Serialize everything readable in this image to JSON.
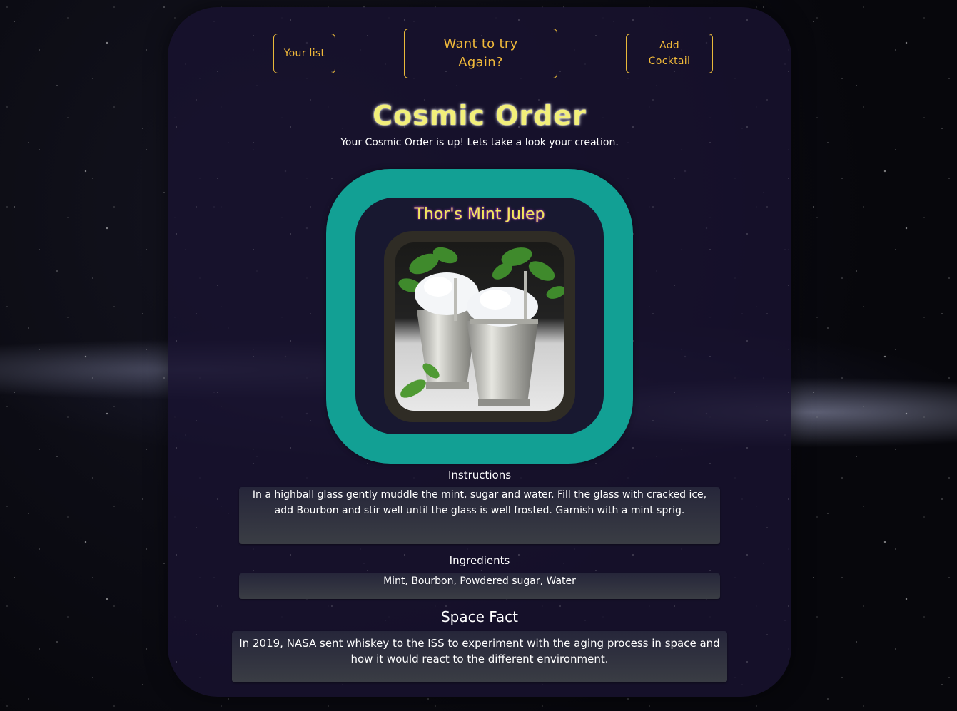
{
  "nav": {
    "list_label": "Your list",
    "again_label": "Want to try Again?",
    "add_label": "Add Cocktail"
  },
  "header": {
    "title": "Cosmic Order",
    "subtitle": "Your Cosmic Order is up! Lets take a look your creation."
  },
  "drink": {
    "name": "Thor's Mint Julep",
    "image_icon": "cocktail-photo"
  },
  "instructions": {
    "label": "Instructions",
    "text": "In a highball glass gently muddle the mint, sugar and water. Fill the glass with cracked ice, add Bourbon and stir well until the glass is well frosted. Garnish with a mint sprig."
  },
  "ingredients": {
    "label": "Ingredients",
    "text": "Mint, Bourbon, Powdered sugar, Water"
  },
  "space_fact": {
    "label": "Space Fact",
    "text": "In 2019, NASA sent whiskey to the ISS to experiment with the aging process in space and how it would react to the different environment."
  },
  "colors": {
    "accent": "#e8b93a",
    "ring": "#12a094",
    "title": "#f2ef7a"
  }
}
